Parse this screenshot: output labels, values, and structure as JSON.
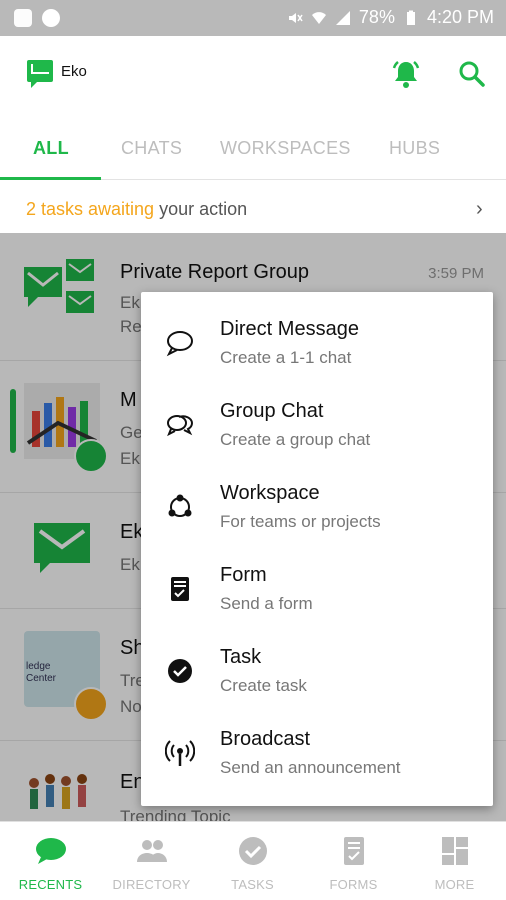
{
  "status_bar": {
    "battery": "78%",
    "time": "4:20 PM"
  },
  "app": {
    "name": "Eko",
    "brand_color": "#1fb84a",
    "accent_color": "#f4a61d"
  },
  "header_icons": [
    "bell-icon",
    "search-icon"
  ],
  "tabs": [
    {
      "label": "ALL",
      "active": true
    },
    {
      "label": "CHATS",
      "active": false
    },
    {
      "label": "WORKSPACES",
      "active": false
    },
    {
      "label": "HUBS",
      "active": false
    }
  ],
  "tasks_banner": {
    "highlight": "2 tasks awaiting",
    "rest": " your action"
  },
  "list": [
    {
      "title": "Private Report Group",
      "line1": "Ek",
      "line2": "Re",
      "time": "3:59 PM"
    },
    {
      "title": "M",
      "line1": "Ge",
      "line2": "Ek",
      "time": ""
    },
    {
      "title": "Ek",
      "line1": "Ek",
      "line2": "",
      "time": ""
    },
    {
      "title": "Sh",
      "line1": "Tre",
      "line2": "No",
      "time": "",
      "avatar_text": "ledge Center"
    },
    {
      "title": "En",
      "line1": "Trending Topic",
      "line2": "",
      "time": ""
    }
  ],
  "menu": [
    {
      "title": "Direct Message",
      "subtitle": "Create a 1-1 chat",
      "icon": "chat-bubble-icon"
    },
    {
      "title": "Group Chat",
      "subtitle": "Create a group chat",
      "icon": "group-chat-icon"
    },
    {
      "title": "Workspace",
      "subtitle": "For teams or projects",
      "icon": "workspace-icon"
    },
    {
      "title": "Form",
      "subtitle": "Send a form",
      "icon": "form-icon"
    },
    {
      "title": "Task",
      "subtitle": "Create task",
      "icon": "task-check-icon"
    },
    {
      "title": "Broadcast",
      "subtitle": "Send an announcement",
      "icon": "broadcast-icon"
    }
  ],
  "bottom_nav": [
    {
      "label": "RECENTS",
      "active": true
    },
    {
      "label": "DIRECTORY",
      "active": false
    },
    {
      "label": "TASKS",
      "active": false
    },
    {
      "label": "FORMS",
      "active": false
    },
    {
      "label": "MORE",
      "active": false
    }
  ]
}
